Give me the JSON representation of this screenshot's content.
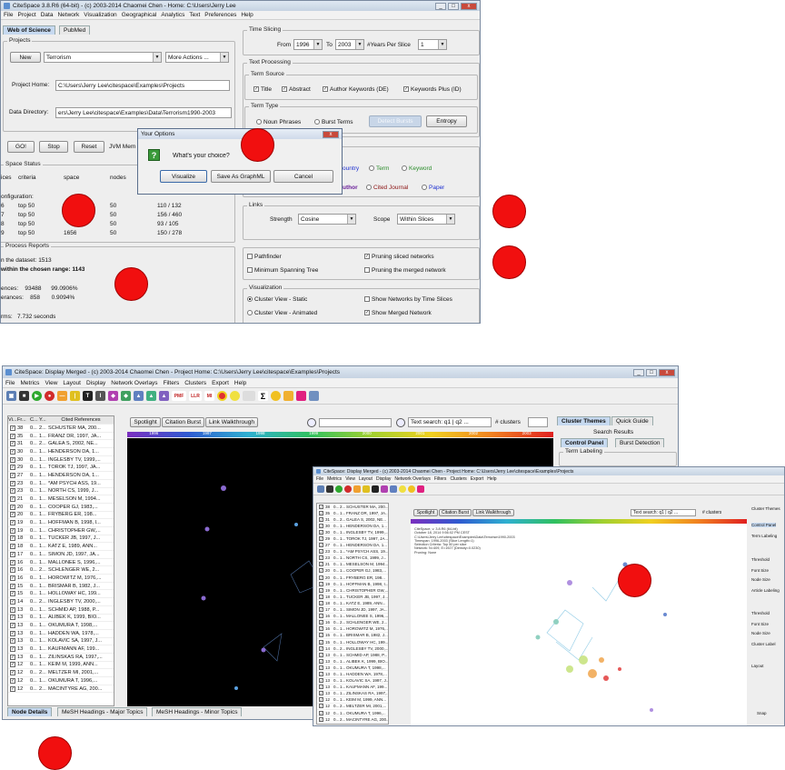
{
  "w1": {
    "title": "CiteSpace 3.8.R6 (64-bit) - (c) 2003-2014 Chaomei Chen - Home: C:\\Users\\Jerry Lee",
    "menu": [
      "File",
      "Project",
      "Data",
      "Network",
      "Visualization",
      "Geographical",
      "Analytics",
      "Text",
      "Preferences",
      "Help"
    ],
    "tabs": [
      "Web of Science",
      "PubMed"
    ],
    "projects_label": "Projects",
    "new_btn": "New",
    "project_select": "Terrorism",
    "more_actions": "More Actions ...",
    "project_home_label": "Project Home:",
    "project_home_value": "C:\\Users\\Jerry Lee\\citespace\\Examples\\Projects",
    "data_dir_label": "Data Directory:",
    "data_dir_value": "ers\\Jerry Lee\\citespace\\Examples\\Data\\Terrorism1990-2003",
    "go_btn": "GO!",
    "stop_btn": "Stop",
    "reset_btn": "Reset",
    "jvm_label": "JVM Mem",
    "space_status_label": "Space Status",
    "space_cols": [
      "ices",
      "criteria",
      "space",
      "nodes"
    ],
    "config_label": "onfiguration:",
    "space_rows": [
      [
        "6",
        "top 50",
        "",
        "50",
        "110 / 132"
      ],
      [
        "7",
        "top 50",
        "",
        "50",
        "156 / 460"
      ],
      [
        "8",
        "top 50",
        "",
        "50",
        "93 / 105"
      ],
      [
        "9",
        "top 50",
        "1656",
        "50",
        "150 / 278"
      ]
    ],
    "reports_label": "Process Reports",
    "report_lines": [
      "n the dataset: 1513",
      "within the chosen range: 1143",
      "",
      "ences:    93488      99.0906%",
      "erances:    858       0.9094%",
      "",
      "rms:   7.732 seconds"
    ],
    "time_slicing_label": "Time Slicing",
    "from_label": "From",
    "from_val": "1996",
    "to_label": "To",
    "to_val": "2003",
    "years_label": "#Years Per Slice",
    "years_val": "1",
    "text_processing_label": "Text Processing",
    "term_source_label": "Term Source",
    "term_sources": [
      "Title",
      "Abstract",
      "Author Keywords (DE)",
      "Keywords Plus (ID)"
    ],
    "term_type_label": "Term Type",
    "term_types": [
      "Noun Phrases",
      "Burst Terms"
    ],
    "detect_bursts": "Detect Bursts",
    "entropy_btn": "Entropy",
    "node_types_row1": [
      "ountry",
      "Term",
      "Keyword"
    ],
    "node_types_row2": [
      "uthor",
      "Cited Journal",
      "Paper"
    ],
    "links_label": "Links",
    "strength_label": "Strength",
    "strength_val": "Cosine",
    "scope_label": "Scope",
    "scope_val": "Within Slices",
    "pruning": [
      "Pathfinder",
      "Pruning sliced networks",
      "Minimum Spanning Tree",
      "Pruning the merged network"
    ],
    "viz_label": "Visualization",
    "viz_opts": [
      "Cluster View - Static",
      "Show Networks by Time Slices",
      "Cluster View - Animated",
      "Show Merged Network"
    ]
  },
  "dialog": {
    "title": "Your Options",
    "question": "What's your choice?",
    "icon": "?",
    "buttons": [
      "Visualize",
      "Save As GraphML",
      "Cancel"
    ]
  },
  "w2": {
    "title": "CiteSpace: Display Merged - (c) 2003-2014 Chaomei Chen - Project Home: C:\\Users\\Jerry Lee\\citespace\\Examples\\Projects",
    "menu": [
      "File",
      "Metrics",
      "View",
      "Layout",
      "Display",
      "Network Overlays",
      "Filters",
      "Clusters",
      "Export",
      "Help"
    ],
    "table_cols": [
      "Vi...",
      "Fr...",
      "C...",
      "Y...",
      "Cited References"
    ],
    "rows": [
      [
        "38",
        "0...",
        "2...",
        "SCHUSTER MA, 200..."
      ],
      [
        "35",
        "0...",
        "1...",
        "FRANZ DR, 1997, JA..."
      ],
      [
        "31",
        "0...",
        "2...",
        "GALEA S, 2002, NE..."
      ],
      [
        "30",
        "0...",
        "1...",
        "HENDERSON DA, 1..."
      ],
      [
        "30",
        "0...",
        "1...",
        "INGLESBY TV, 1999,..."
      ],
      [
        "29",
        "0...",
        "1...",
        "TOROK TJ, 1997, JA..."
      ],
      [
        "27",
        "0...",
        "1...",
        "HENDERSON DA, 1..."
      ],
      [
        "23",
        "0...",
        "1...",
        "*AM PSYCH ASS, 19..."
      ],
      [
        "23",
        "0...",
        "1...",
        "NORTH CS, 1999, J..."
      ],
      [
        "21",
        "0...",
        "1...",
        "MESELSON M, 1994..."
      ],
      [
        "20",
        "0...",
        "1...",
        "COOPER GJ, 1983,..."
      ],
      [
        "20",
        "0...",
        "1...",
        "FRYBERG ER, 198..."
      ],
      [
        "19",
        "0...",
        "1...",
        "HOFFMAN B, 1998, I..."
      ],
      [
        "19",
        "0...",
        "1...",
        "CHRISTOPHER GW,..."
      ],
      [
        "18",
        "0...",
        "1...",
        "TUCKER JB, 1997, J..."
      ],
      [
        "18",
        "0...",
        "1...",
        "KATZ E, 1989, ANN..."
      ],
      [
        "17",
        "0...",
        "1...",
        "SIMON JD, 1997, JA..."
      ],
      [
        "16",
        "0...",
        "1...",
        "MALLONEE S, 1996,..."
      ],
      [
        "16",
        "0...",
        "2...",
        "SCHLENGER WE, 2..."
      ],
      [
        "16",
        "0...",
        "1...",
        "HOROWITZ M, 1976,..."
      ],
      [
        "15",
        "0...",
        "1...",
        "BRISMAR B, 1982, J..."
      ],
      [
        "15",
        "0...",
        "1...",
        "HOLLOWAY HC, 199..."
      ],
      [
        "14",
        "0...",
        "2...",
        "INGLESBY TV, 2000,..."
      ],
      [
        "13",
        "0...",
        "1...",
        "SCHMID AP, 1988, P..."
      ],
      [
        "13",
        "0...",
        "1...",
        "ALIBEK K, 1999, BIO..."
      ],
      [
        "13",
        "0...",
        "1...",
        "OKUMURA T, 1998,..."
      ],
      [
        "13",
        "0...",
        "1...",
        "HADDEN WA, 1978,..."
      ],
      [
        "13",
        "0...",
        "1...",
        "KOLAVIC SA, 1997, J..."
      ],
      [
        "13",
        "0...",
        "1...",
        "KAUFMANN AF, 199..."
      ],
      [
        "13",
        "0...",
        "1...",
        "ZILINSKAS RA, 1997,..."
      ],
      [
        "12",
        "0...",
        "1...",
        "KEIM M, 1999, ANN..."
      ],
      [
        "12",
        "0...",
        "2...",
        "MELTZER MI, 2001,..."
      ],
      [
        "12",
        "0...",
        "1...",
        "OKUMURA T, 1996,..."
      ],
      [
        "12",
        "0...",
        "2...",
        "MACINTYRE AG, 200..."
      ]
    ],
    "spotlight": "Spotlight",
    "citation_burst": "Citation Burst",
    "link_walkthrough": "Link Walkthrough",
    "search_text": "Text search: q1 | q2 ...",
    "clusters_label": "# clusters",
    "years": [
      "1996",
      "1997",
      "1998",
      "1999",
      "2000",
      "2001",
      "2002",
      "2003"
    ],
    "right_tabs": [
      "Cluster Themes",
      "Quick Guide"
    ],
    "search_results": "Search Results",
    "control_panel": "Control Panel",
    "burst_detection": "Burst Detection",
    "term_labeling": "Term Labeling",
    "bottom_tabs": [
      "Node Details",
      "MeSH Headings - Major Topics",
      "MeSH Headings - Minor Topics"
    ],
    "toolbar_icons": [
      "save-icon",
      "camera-icon",
      "play-icon",
      "stop-icon",
      "line-icon",
      "bar-icon",
      "tfidf-icon",
      "ti-icon",
      "cluster-icon",
      "cluster2-icon",
      "triangle-icon",
      "triangle2-icon",
      "triangle3-icon",
      "pmf-icon",
      "llr-icon",
      "mi-icon",
      "ring-icon",
      "sun-icon",
      "map-icon",
      "sigma-icon",
      "search-icon",
      "color-icon",
      "dots-icon",
      "bridge-icon"
    ],
    "toolbar_labels": {
      "pmf": "PMF",
      "llr": "LLR",
      "mi": "MI",
      "sigma": "Σ"
    }
  },
  "w3": {
    "title": "CiteSpace: Display Merged - (c) 2003-2014 Chaomei Chen - Project Home: C:\\Users\\Jerry Lee\\citespace\\Examples\\Projects",
    "menu": [
      "File",
      "Metrics",
      "View",
      "Layout",
      "Display",
      "Network Overlays",
      "Filters",
      "Clusters",
      "Export",
      "Help"
    ],
    "info_lines": [
      "CiteSpace, v. 3.8.R6 (64-bit)",
      "October 18, 2014 9:56:02 PM CEST",
      "C:\\Users\\Jerry Lee\\citespace\\Examples\\Data\\Terrorism1990-2003",
      "Timespan: 1996-2003 (Slice Length=1)",
      "Selection Criteria: Top 50 per slice",
      "Network: N=409, E=1927 (Density=0.0230)",
      "Pruning: None"
    ],
    "right_labels": [
      "Cluster Themes",
      "Search Results",
      "Control Panel",
      "Term Labeling",
      "Threshold",
      "Font Size",
      "Node Size",
      "Article Labeling",
      "Threshold",
      "Font Size",
      "Node Size",
      "Cluster Label",
      "Layout",
      "Snap"
    ]
  },
  "colors": {
    "marker": "#f10f0f",
    "canvas": "#000000",
    "titlebar": "#c6d3e2",
    "selected_tab": "#c6d9f0"
  }
}
